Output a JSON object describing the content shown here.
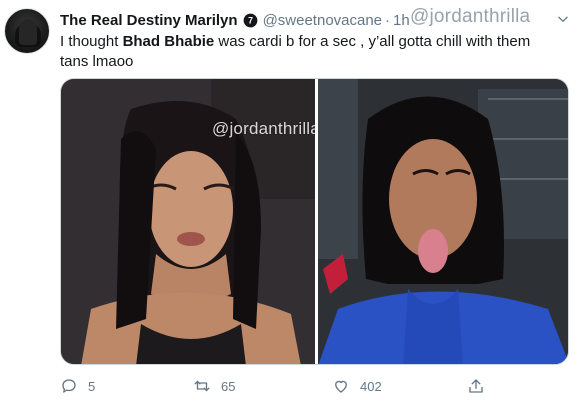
{
  "tweet": {
    "display_name": "The Real Destiny Marilyn",
    "handle": "@sweetnovacane",
    "separator": "·",
    "time": "1h",
    "watermark": "@jordanthrilla",
    "text_before": "I thought ",
    "text_bold": "Bhad Bhabie",
    "text_after": " was cardi b for a sec , y’all gotta chill with them tans lmaoo",
    "photo_watermark": "@jordanthrilla",
    "actions": {
      "replies": "5",
      "retweets": "65",
      "likes": "402"
    }
  },
  "icons": {
    "verified": "verified-badge-icon",
    "caret": "chevron-down-icon",
    "reply": "reply-icon",
    "retweet": "retweet-icon",
    "like": "heart-icon",
    "share": "share-icon"
  },
  "colors": {
    "text": "#14171a",
    "muted": "#657786",
    "border": "#ccd6dd"
  }
}
